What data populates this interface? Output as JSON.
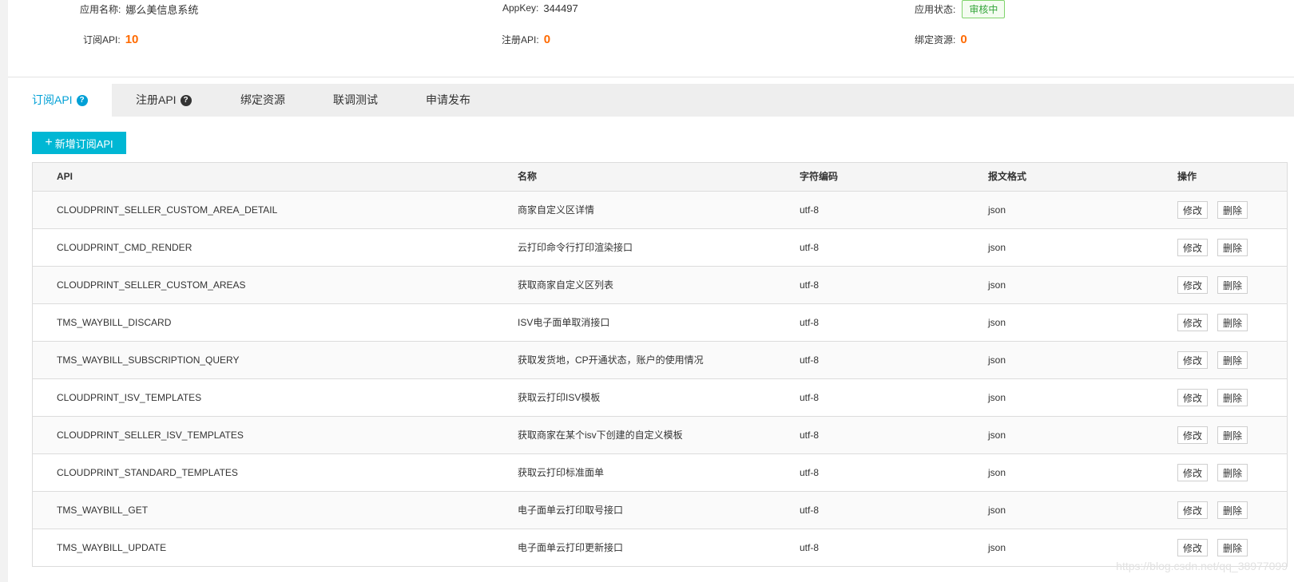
{
  "app_info": {
    "name_label": "应用名称:",
    "name_value": "娜么美信息系统",
    "appkey_label": "AppKey:",
    "appkey_value": "344497",
    "status_label": "应用状态:",
    "status_value": "审核中",
    "subscribed_label": "订阅API:",
    "subscribed_value": "10",
    "registered_label": "注册API:",
    "registered_value": "0",
    "bound_label": "绑定资源:",
    "bound_value": "0"
  },
  "tabs": [
    {
      "label": "订阅API",
      "help": "?"
    },
    {
      "label": "注册API",
      "help": "?"
    },
    {
      "label": "绑定资源"
    },
    {
      "label": "联调测试"
    },
    {
      "label": "申请发布"
    }
  ],
  "add_button": {
    "icon": "plus-icon",
    "label": "新增订阅API"
  },
  "table": {
    "headers": [
      "API",
      "名称",
      "字符编码",
      "报文格式",
      "操作"
    ],
    "rows": [
      {
        "api": "CLOUDPRINT_SELLER_CUSTOM_AREA_DETAIL",
        "name": "商家自定义区详情",
        "charset": "utf-8",
        "format": "json",
        "edit": "修改",
        "delete": "删除"
      },
      {
        "api": "CLOUDPRINT_CMD_RENDER",
        "name": "云打印命令行打印渲染接口",
        "charset": "utf-8",
        "format": "json",
        "edit": "修改",
        "delete": "删除"
      },
      {
        "api": "CLOUDPRINT_SELLER_CUSTOM_AREAS",
        "name": "获取商家自定义区列表",
        "charset": "utf-8",
        "format": "json",
        "edit": "修改",
        "delete": "删除"
      },
      {
        "api": "TMS_WAYBILL_DISCARD",
        "name": "ISV电子面单取消接口",
        "charset": "utf-8",
        "format": "json",
        "edit": "修改",
        "delete": "删除"
      },
      {
        "api": "TMS_WAYBILL_SUBSCRIPTION_QUERY",
        "name": "获取发货地，CP开通状态，账户的使用情况",
        "charset": "utf-8",
        "format": "json",
        "edit": "修改",
        "delete": "删除"
      },
      {
        "api": "CLOUDPRINT_ISV_TEMPLATES",
        "name": "获取云打印ISV模板",
        "charset": "utf-8",
        "format": "json",
        "edit": "修改",
        "delete": "删除"
      },
      {
        "api": "CLOUDPRINT_SELLER_ISV_TEMPLATES",
        "name": "获取商家在某个isv下创建的自定义模板",
        "charset": "utf-8",
        "format": "json",
        "edit": "修改",
        "delete": "删除"
      },
      {
        "api": "CLOUDPRINT_STANDARD_TEMPLATES",
        "name": "获取云打印标准面单",
        "charset": "utf-8",
        "format": "json",
        "edit": "修改",
        "delete": "删除"
      },
      {
        "api": "TMS_WAYBILL_GET",
        "name": "电子面单云打印取号接口",
        "charset": "utf-8",
        "format": "json",
        "edit": "修改",
        "delete": "删除"
      },
      {
        "api": "TMS_WAYBILL_UPDATE",
        "name": "电子面单云打印更新接口",
        "charset": "utf-8",
        "format": "json",
        "edit": "修改",
        "delete": "删除"
      }
    ]
  },
  "watermark": "https://blog.csdn.net/qq_38977099",
  "colors": {
    "accent": "#00b7d4",
    "number": "#ff6a00",
    "status_green": "#34a53a"
  }
}
